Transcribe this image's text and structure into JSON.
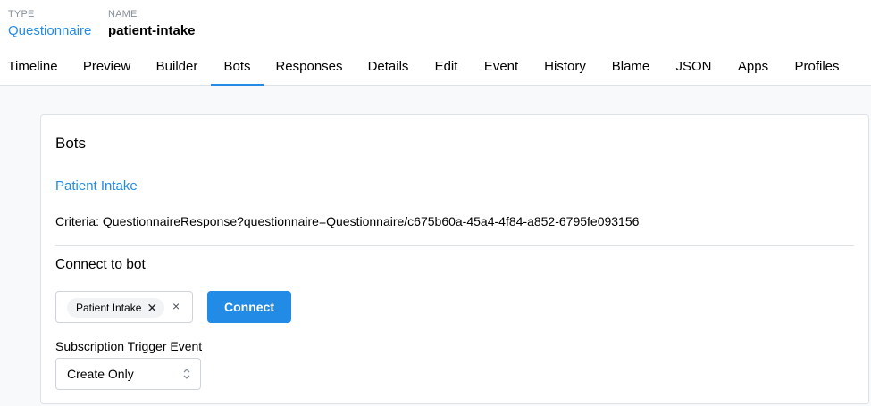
{
  "header": {
    "type_label": "TYPE",
    "type_value": "Questionnaire",
    "name_label": "NAME",
    "name_value": "patient-intake"
  },
  "tabs": [
    {
      "label": "Timeline"
    },
    {
      "label": "Preview"
    },
    {
      "label": "Builder"
    },
    {
      "label": "Bots",
      "active": true
    },
    {
      "label": "Responses"
    },
    {
      "label": "Details"
    },
    {
      "label": "Edit"
    },
    {
      "label": "Event"
    },
    {
      "label": "History"
    },
    {
      "label": "Blame"
    },
    {
      "label": "JSON"
    },
    {
      "label": "Apps"
    },
    {
      "label": "Profiles"
    }
  ],
  "card": {
    "title": "Bots",
    "bot_link": "Patient Intake",
    "criteria": "Criteria: QuestionnaireResponse?questionnaire=Questionnaire/c675b60a-45a4-4f84-a852-6795fe093156",
    "connect_title": "Connect to bot",
    "selected_bot": "Patient Intake",
    "connect_button": "Connect",
    "trigger_label": "Subscription Trigger Event",
    "trigger_value": "Create Only"
  },
  "colors": {
    "accent": "#228be6"
  },
  "icons": {
    "pill_remove": "close-icon",
    "clear": "close-icon",
    "select": "chevron-up-down-icon"
  }
}
